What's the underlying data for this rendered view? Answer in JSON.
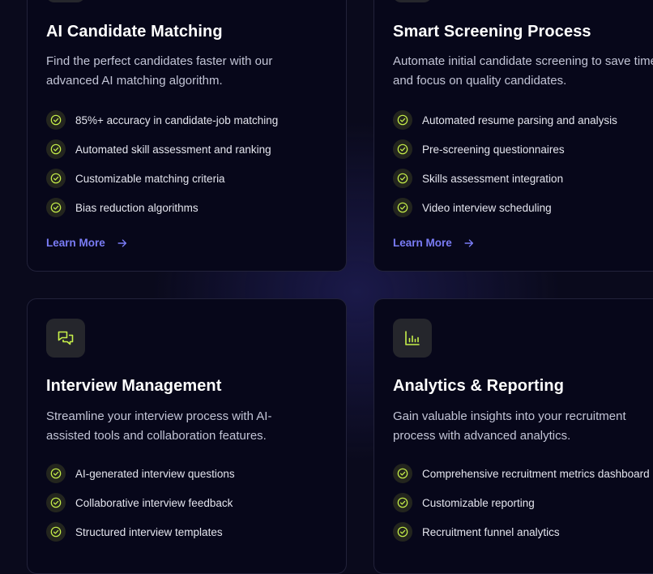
{
  "colors": {
    "accent": "#c7f04a",
    "link": "#7a7cf6",
    "background": "#0a0a1c",
    "card": "#07071a"
  },
  "cards": [
    {
      "icon": "target-icon",
      "title": "AI Candidate Matching",
      "description": "Find the perfect candidates faster with our advanced AI matching algorithm.",
      "features": [
        "85%+ accuracy in candidate-job matching",
        "Automated skill assessment and ranking",
        "Customizable matching criteria",
        "Bias reduction algorithms"
      ],
      "link": "Learn More"
    },
    {
      "icon": "filter-icon",
      "title": "Smart Screening Process",
      "description": "Automate initial candidate screening to save time and focus on quality candidates.",
      "features": [
        "Automated resume parsing and analysis",
        "Pre-screening questionnaires",
        "Skills assessment integration",
        "Video interview scheduling"
      ],
      "link": "Learn More"
    },
    {
      "icon": "chat-bubbles-icon",
      "title": "Interview Management",
      "description": "Streamline your interview process with AI-assisted tools and collaboration features.",
      "features": [
        "AI-generated interview questions",
        "Collaborative interview feedback",
        "Structured interview templates"
      ]
    },
    {
      "icon": "bar-chart-icon",
      "title": "Analytics & Reporting",
      "description": "Gain valuable insights into your recruitment process with advanced analytics.",
      "features": [
        "Comprehensive recruitment metrics dashboard",
        "Customizable reporting",
        "Recruitment funnel analytics"
      ]
    }
  ]
}
